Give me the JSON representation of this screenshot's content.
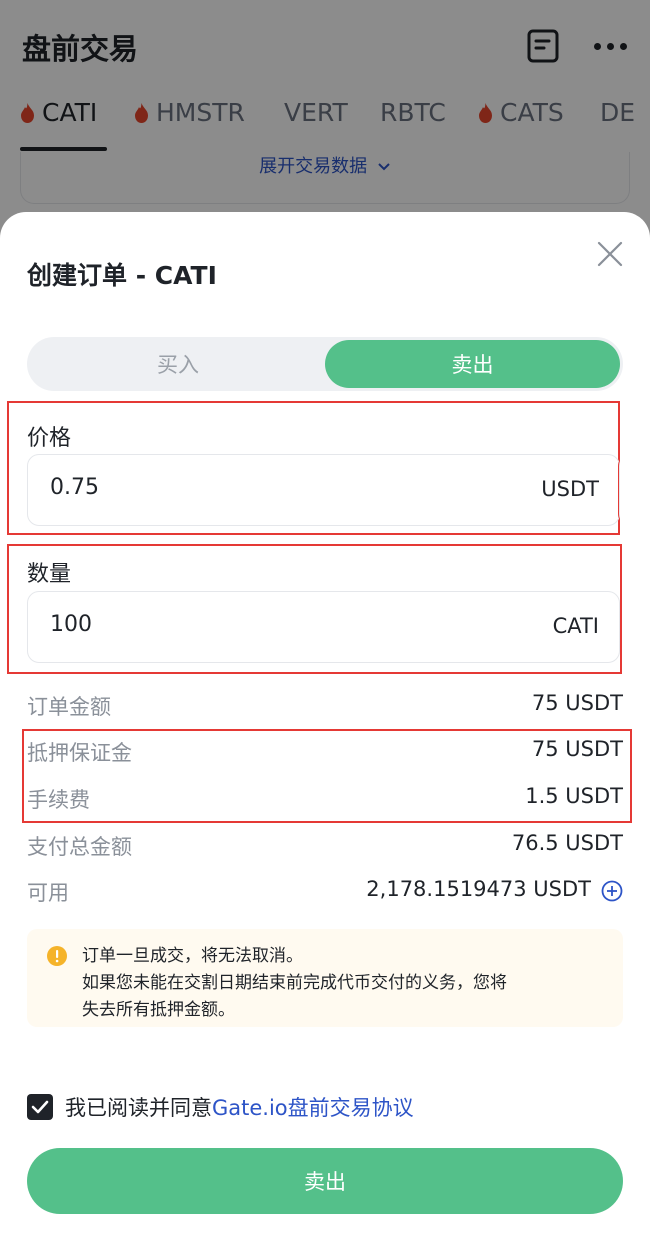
{
  "app": {
    "title": "盘前交易",
    "tabs": [
      {
        "label": "CATI",
        "hot": true,
        "active": true
      },
      {
        "label": "HMSTR",
        "hot": true,
        "active": false
      },
      {
        "label": "VERT",
        "hot": false,
        "active": false
      },
      {
        "label": "RBTC",
        "hot": false,
        "active": false
      },
      {
        "label": "CATS",
        "hot": true,
        "active": false
      },
      {
        "label": "DE",
        "hot": false,
        "active": false
      }
    ],
    "expand_label": "展开交易数据",
    "icons": {
      "records": "document-icon",
      "more": "more-icon",
      "hot": "flame-icon"
    }
  },
  "sheet": {
    "title": "创建订单 - CATI",
    "side_buy_label": "买入",
    "side_sell_label": "卖出",
    "selected_side": "sell",
    "price": {
      "label": "价格",
      "value": "0.75",
      "unit": "USDT"
    },
    "quantity": {
      "label": "数量",
      "value": "100",
      "unit": "CATI"
    },
    "summary": [
      {
        "label": "订单金额",
        "value": "75 USDT"
      },
      {
        "label": "抵押保证金",
        "value": "75 USDT"
      },
      {
        "label": "手续费",
        "value": "1.5 USDT"
      },
      {
        "label": "支付总金额",
        "value": "76.5 USDT"
      },
      {
        "label": "可用",
        "value": "2,178.1519473 USDT"
      }
    ],
    "notice": {
      "line1": "订单一旦成交，将无法取消。",
      "line2": "如果您未能在交割日期结束前完成代币交付的义务，您将",
      "line3": "失去所有抵押金额。"
    },
    "agreement": {
      "prefix": "我已阅读并同意",
      "link": "Gate.io盘前交易协议",
      "checked": true
    },
    "submit_label": "卖出"
  },
  "colors": {
    "accent_green": "#54c08a",
    "link_blue": "#2d54c7",
    "flame_red": "#e8452c",
    "highlight_red": "#e53935",
    "notice_bg": "#fffaf0",
    "warning_yellow": "#f5b32a"
  }
}
